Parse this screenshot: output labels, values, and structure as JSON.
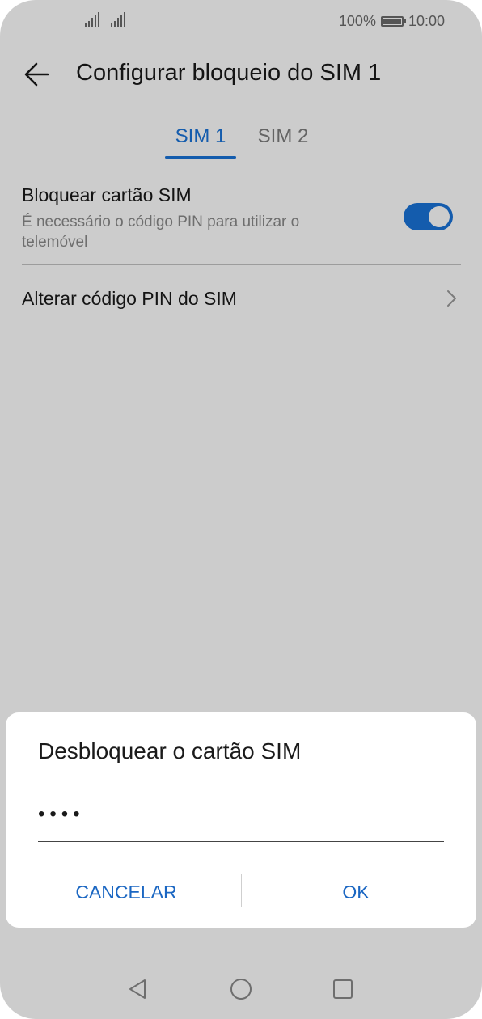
{
  "status_bar": {
    "battery_text": "100%",
    "time": "10:00",
    "battery_level": 1.0
  },
  "header": {
    "title": "Configurar bloqueio do SIM 1",
    "back_icon": "arrow-left-icon"
  },
  "tabs": [
    {
      "label": "SIM 1",
      "selected": true
    },
    {
      "label": "SIM 2",
      "selected": false
    }
  ],
  "settings": {
    "lock_sim": {
      "title": "Bloquear cartão SIM",
      "subtitle": "É necessário o código PIN para utilizar o telemóvel",
      "enabled": true
    },
    "change_pin": {
      "label": "Alterar código PIN do SIM"
    }
  },
  "dialog": {
    "title": "Desbloquear o cartão SIM",
    "pin_masked": "••••",
    "cancel_label": "CANCELAR",
    "ok_label": "OK"
  },
  "colors": {
    "accent": "#1a73d9",
    "dialog_button": "#1a66c2"
  }
}
